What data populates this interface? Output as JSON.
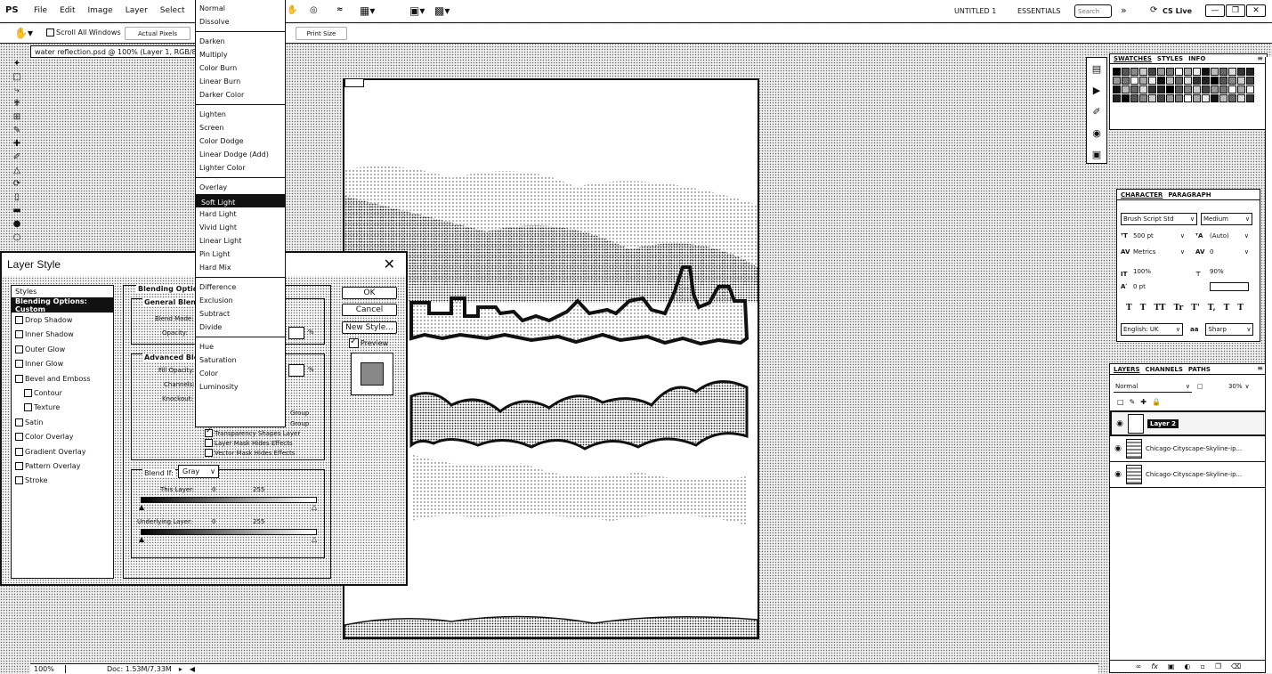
{
  "app": {
    "logo": "PS",
    "menus": [
      "File",
      "Edit",
      "Image",
      "Layer",
      "Select",
      "Filter"
    ],
    "workspace_doc": "UNTITLED 1",
    "workspace_name": "ESSENTIALS",
    "search_placeholder": "Search",
    "cslive": "CS Live"
  },
  "options_bar": {
    "scroll_all": "Scroll All Windows",
    "actual_pixels": "Actual Pixels",
    "print_size": "Print Size"
  },
  "document": {
    "tab_title": "water reflection.psd @ 100% (Layer 1, RGB/8)",
    "zoom": "100%",
    "doc_size": "Doc: 1.53M/7.33M"
  },
  "blend_menu": {
    "groups": [
      [
        "Normal",
        "Dissolve"
      ],
      [
        "Darken",
        "Multiply",
        "Color Burn",
        "Linear Burn",
        "Darker Color"
      ],
      [
        "Lighten",
        "Screen",
        "Color Dodge",
        "Linear Dodge (Add)",
        "Lighter Color"
      ],
      [
        "Overlay",
        "Soft Light",
        "Hard Light",
        "Vivid Light",
        "Linear Light",
        "Pin Light",
        "Hard Mix"
      ],
      [
        "Difference",
        "Exclusion",
        "Subtract",
        "Divide"
      ],
      [
        "Hue",
        "Saturation",
        "Color",
        "Luminosity"
      ]
    ],
    "selected": "Soft Light"
  },
  "layer_style": {
    "title": "Layer Style",
    "styles_header": "Styles",
    "items": [
      {
        "label": "Blending Options: Custom",
        "checkbox": false,
        "active": true,
        "indent": false
      },
      {
        "label": "Drop Shadow",
        "checkbox": true,
        "active": false,
        "indent": false
      },
      {
        "label": "Inner Shadow",
        "checkbox": true,
        "active": false,
        "indent": false
      },
      {
        "label": "Outer Glow",
        "checkbox": true,
        "active": false,
        "indent": false
      },
      {
        "label": "Inner Glow",
        "checkbox": true,
        "active": false,
        "indent": false
      },
      {
        "label": "Bevel and Emboss",
        "checkbox": true,
        "active": false,
        "indent": false
      },
      {
        "label": "Contour",
        "checkbox": true,
        "active": false,
        "indent": true
      },
      {
        "label": "Texture",
        "checkbox": true,
        "active": false,
        "indent": true
      },
      {
        "label": "Satin",
        "checkbox": true,
        "active": false,
        "indent": false
      },
      {
        "label": "Color Overlay",
        "checkbox": true,
        "active": false,
        "indent": false
      },
      {
        "label": "Gradient Overlay",
        "checkbox": true,
        "active": false,
        "indent": false
      },
      {
        "label": "Pattern Overlay",
        "checkbox": true,
        "active": false,
        "indent": false
      },
      {
        "label": "Stroke",
        "checkbox": true,
        "active": false,
        "indent": false
      }
    ],
    "blending_options_title": "Blending Options",
    "general_blending": "General Blend",
    "blend_mode_label": "Blend Mode:",
    "opacity_label": "Opacity:",
    "percent": "%",
    "advanced_blending": "Advanced Ble",
    "fill_opacity_label": "Fill Opacity:",
    "channels_label": "Channels:",
    "knockout_label": "Knockout:",
    "group_a": "Group",
    "group_b": "Group",
    "transparency_shapes": "Transparency Shapes Layer",
    "layer_mask_hides": "Layer Mask Hides Effects",
    "vector_mask_hides": "Vector Mask Hides Effects",
    "blend_if_label": "Blend If:",
    "blend_if_value": "Gray",
    "this_layer_label": "This Layer:",
    "this_layer_min": "0",
    "this_layer_max": "255",
    "underlying_label": "Underlying Layer:",
    "underlying_min": "0",
    "underlying_max": "255",
    "ok": "OK",
    "cancel": "Cancel",
    "new_style": "New Style...",
    "preview": "Preview"
  },
  "swatches_panel": {
    "tabs": [
      "SWATCHES",
      "STYLES",
      "INFO"
    ]
  },
  "character_panel": {
    "tabs": [
      "CHARACTER",
      "PARAGRAPH"
    ],
    "font_family": "Brush Script Std",
    "font_style": "Medium",
    "size": "500 pt",
    "leading": "(Auto)",
    "kerning": "Metrics",
    "tracking": "0",
    "vscale": "100%",
    "hscale": "90%",
    "baseline": "0 pt",
    "type_buttons": [
      "T",
      "T",
      "TT",
      "Tr",
      "T'",
      "T,",
      "T",
      "T"
    ],
    "language": "English: UK",
    "aa_label": "aa",
    "antialias": "Sharp"
  },
  "layers_panel": {
    "tabs": [
      "LAYERS",
      "CHANNELS",
      "PATHS"
    ],
    "blend_mode": "Normal",
    "opacity": "30%",
    "layers": [
      {
        "name": "Layer 2",
        "selected": true
      },
      {
        "name": "Chicago-Cityscape-Skyline-ip...",
        "selected": false
      },
      {
        "name": "Chicago-Cityscape-Skyline-ip...",
        "selected": false
      }
    ]
  }
}
